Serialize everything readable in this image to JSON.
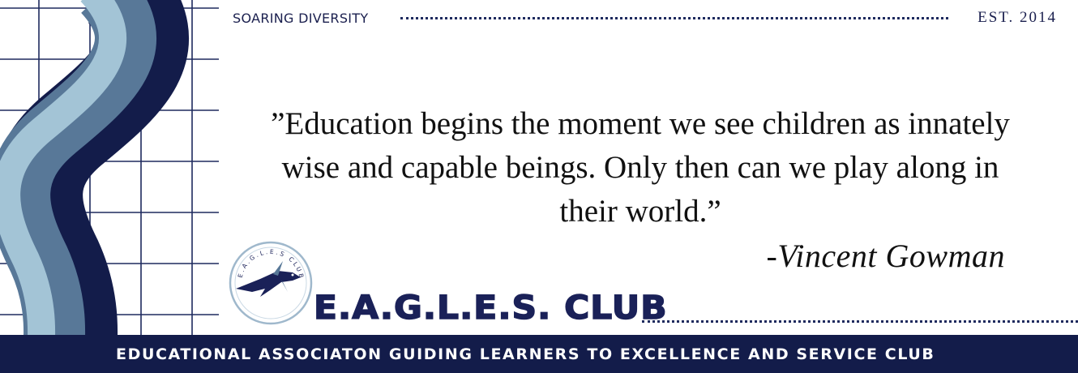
{
  "header": {
    "tagline": "SOARING DIVERSITY",
    "established": "EST. 2014"
  },
  "quote": {
    "text": "”Education begins the moment we see children as innately wise and capable beings. Only then can we play along in their world.”",
    "author": "-Vincent Gowman"
  },
  "club": {
    "name": "E.A.G.L.E.S. CLUB",
    "logo_ring_text": "E.A.G.L.E.S CLUB",
    "full_name": "EDUCATIONAL ASSOCIATON GUIDING LEARNERS TO EXCELLENCE AND SERVICE CLUB"
  },
  "colors": {
    "navy": "#131c4a",
    "steel_blue": "#587898",
    "light_blue": "#a3c4d6",
    "grid_line": "#1e2a5e"
  }
}
